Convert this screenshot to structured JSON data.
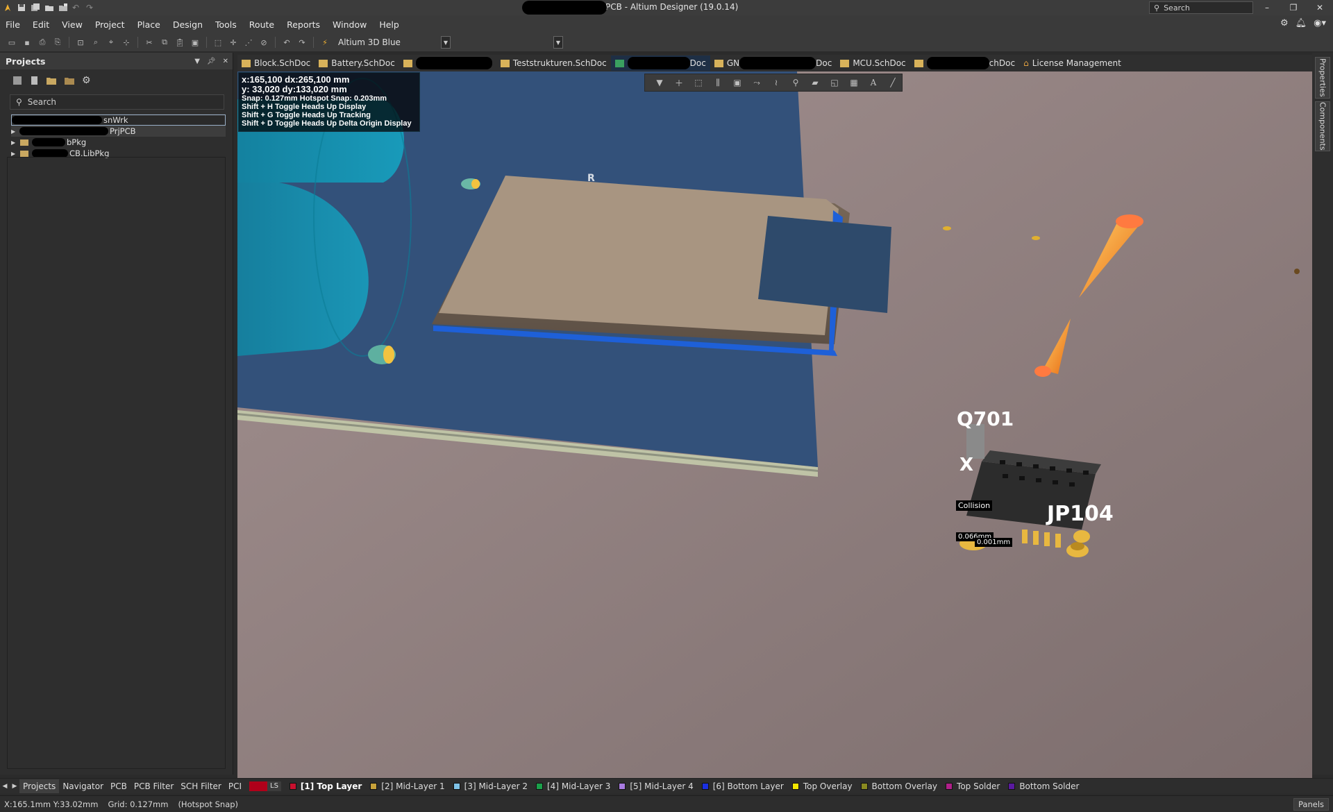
{
  "window": {
    "title": "PrjPCB - Altium Designer (19.0.14)",
    "search_placeholder": "Search",
    "controls": [
      "–",
      "❐",
      "✕"
    ]
  },
  "menu": [
    "File",
    "Edit",
    "View",
    "Project",
    "Place",
    "Design",
    "Tools",
    "Route",
    "Reports",
    "Window",
    "Help"
  ],
  "toolbar": {
    "view_config": "Altium 3D Blue"
  },
  "projects_panel": {
    "title": "Projects",
    "search_placeholder": "Search",
    "tree": [
      {
        "label": "snWrk",
        "selected": true
      },
      {
        "label": "PrjPCB",
        "highlight": true
      },
      {
        "label": "bPkg"
      },
      {
        "label": "CB.LibPkg"
      }
    ]
  },
  "doc_tabs": [
    {
      "label": "Block.SchDoc"
    },
    {
      "label": "Battery.SchDoc"
    },
    {
      "label": ""
    },
    {
      "label": "Teststrukturen.SchDoc"
    },
    {
      "label": "Doc",
      "active": true
    },
    {
      "label": "GN",
      "suffix": "Doc"
    },
    {
      "label": "MCU.SchDoc"
    },
    {
      "label": "chDoc"
    },
    {
      "label": "License Management"
    }
  ],
  "right_strip": {
    "properties": "Properties",
    "components": "Components"
  },
  "hud": {
    "line1": "x:165,100    dx:265,100 mm",
    "line2": "y: 33,020     dy:133,020 mm",
    "line3": "Snap: 0.127mm Hotspot Snap: 0.203mm",
    "line4": "Shift + H  Toggle Heads Up Display",
    "line5": "Shift + G  Toggle Heads Up Tracking",
    "line6": "Shift + D  Toggle Heads Up Delta Origin Display"
  },
  "viewport_labels": {
    "q701": "Q701",
    "jp104": "JP104",
    "x_label": "X",
    "collision": "Collision",
    "dist1": "0.066mm",
    "dist2": "0.001mm",
    "r_label": "R"
  },
  "bottom_panel_tabs": [
    "Projects",
    "Navigator",
    "PCB",
    "PCB Filter",
    "SCH Filter",
    "PCI"
  ],
  "ls_label": "LS",
  "layers": [
    {
      "label": "[1] Top Layer",
      "color": "#c8102e",
      "active": true
    },
    {
      "label": "[2] Mid-Layer 1",
      "color": "#c8a23a"
    },
    {
      "label": "[3] Mid-Layer 2",
      "color": "#7fc3e8"
    },
    {
      "label": "[4] Mid-Layer 3",
      "color": "#1aa04a"
    },
    {
      "label": "[5] Mid-Layer 4",
      "color": "#a87be0"
    },
    {
      "label": "[6] Bottom Layer",
      "color": "#1a2fe0"
    },
    {
      "label": "Top Overlay",
      "color": "#f2e600"
    },
    {
      "label": "Bottom Overlay",
      "color": "#8a8a20"
    },
    {
      "label": "Top Solder",
      "color": "#b0208a"
    },
    {
      "label": "Bottom Solder",
      "color": "#5a1aa0"
    }
  ],
  "status": {
    "coords": "X:165.1mm Y:33.02mm",
    "grid": "Grid: 0.127mm",
    "snap": "(Hotspot Snap)",
    "panels": "Panels"
  },
  "colors": {
    "board": "#33517a",
    "background": "#8d7b7a",
    "component_top": "#a89581",
    "accent_orange": "#f39a20"
  }
}
